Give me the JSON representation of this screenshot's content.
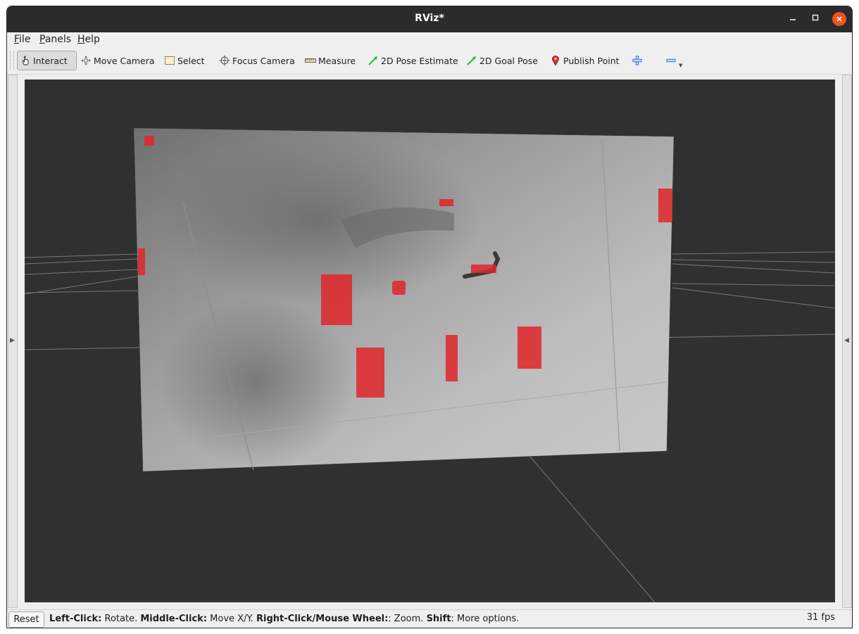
{
  "window": {
    "title": "RViz*"
  },
  "menubar": {
    "items": [
      {
        "label": "File"
      },
      {
        "label": "Panels"
      },
      {
        "label": "Help"
      }
    ]
  },
  "toolbar": {
    "tools": [
      {
        "label": "Interact",
        "icon": "hand-pointer-icon",
        "active": true
      },
      {
        "label": "Move Camera",
        "icon": "move-camera-icon"
      },
      {
        "label": "Select",
        "icon": "select-box-icon"
      },
      {
        "label": "Focus Camera",
        "icon": "focus-crosshair-icon"
      },
      {
        "label": "Measure",
        "icon": "ruler-icon"
      },
      {
        "label": "2D Pose Estimate",
        "icon": "green-arrow-icon"
      },
      {
        "label": "2D Goal Pose",
        "icon": "green-arrow-icon"
      },
      {
        "label": "Publish Point",
        "icon": "map-pin-icon"
      }
    ],
    "add_icon": "plus-icon",
    "remove_icon": "minus-icon"
  },
  "status": {
    "reset_label": "Reset",
    "hint": [
      {
        "bold": "Left-Click:",
        "text": " Rotate. "
      },
      {
        "bold": "Middle-Click:",
        "text": " Move X/Y. "
      },
      {
        "bold": "Right-Click/Mouse Wheel:",
        "text": ": Zoom. "
      },
      {
        "bold": "Shift",
        "text": ": More options."
      }
    ],
    "fps": "31 fps"
  },
  "colors": {
    "viewport_bg": "#303030",
    "marker_red": "#e0262a",
    "titlebar": "#2b2b2b",
    "close_button": "#e95420"
  }
}
